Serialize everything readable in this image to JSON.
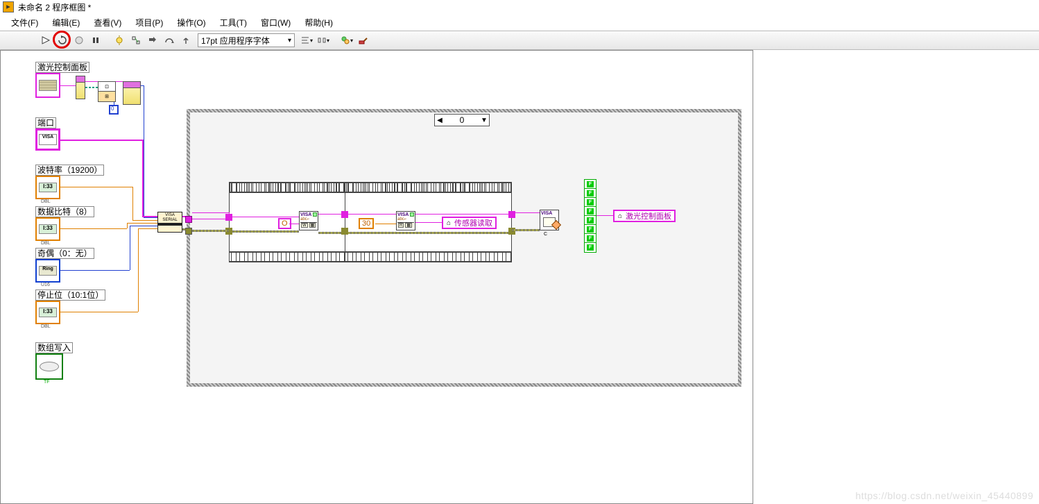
{
  "title": "未命名 2 程序框图 *",
  "menu": {
    "file": "文件(F)",
    "edit": "编辑(E)",
    "view": "查看(V)",
    "project": "项目(P)",
    "operate": "操作(O)",
    "tools": "工具(T)",
    "window": "窗口(W)",
    "help": "帮助(H)"
  },
  "toolbar": {
    "font": "17pt 应用程序字体"
  },
  "labels": {
    "laser_panel": "激光控制面板",
    "port": "端口",
    "baud": "波特率（19200）",
    "data_bits": "数据比特（8）",
    "parity": "奇偶（0：无）",
    "stop_bits": "停止位（10:1位）",
    "array_write": "数组写入"
  },
  "case": {
    "value": "0"
  },
  "constants": {
    "o": "O",
    "thirty": "30",
    "zero": "0",
    "i33": "I:33"
  },
  "nodes": {
    "visa_serial": "VISA SERIAL",
    "visa": "VISA",
    "abc": "abc",
    "w": "W",
    "r": "R",
    "c": "C",
    "sensor_read": "传感器读取",
    "laser_panel_var": "激光控制面板"
  },
  "f_array": [
    "F",
    "F",
    "F",
    "F",
    "F",
    "F",
    "F",
    "F"
  ],
  "watermark": "https://blog.csdn.net/weixin_45440899"
}
